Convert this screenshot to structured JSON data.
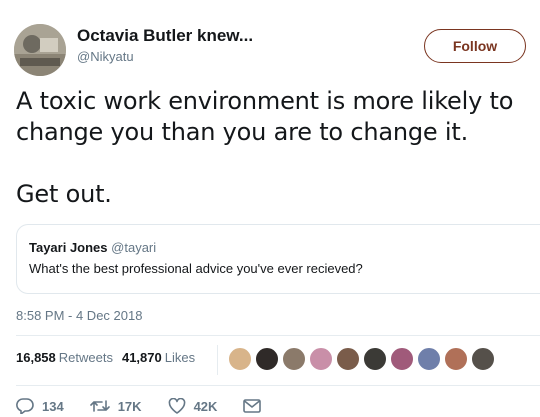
{
  "author": {
    "display_name": "Octavia Butler knew...",
    "handle": "@Nikyatu"
  },
  "follow_label": "Follow",
  "tweet": {
    "line1": "A toxic work environment is more likely to",
    "line2": "change you than you are to change it.",
    "line3": "Get out."
  },
  "quoted": {
    "name": "Tayari Jones",
    "handle": "@tayari",
    "text": "What's the best professional advice you've ever recieved?"
  },
  "timestamp": "8:58 PM - 4 Dec 2018",
  "stats": {
    "retweets_count": "16,858",
    "retweets_label": "Retweets",
    "likes_count": "41,870",
    "likes_label": "Likes"
  },
  "likers": [
    {
      "color": "#d8b48a"
    },
    {
      "color": "#2f2a28"
    },
    {
      "color": "#8b7a6a"
    },
    {
      "color": "#c98fa8"
    },
    {
      "color": "#7a5c4a"
    },
    {
      "color": "#3b3a36"
    },
    {
      "color": "#a05a7a"
    },
    {
      "color": "#6f7faa"
    },
    {
      "color": "#b07058"
    },
    {
      "color": "#55504a"
    }
  ],
  "actions": {
    "replies": "134",
    "retweets": "17K",
    "likes": "42K"
  },
  "colors": {
    "follow_accent": "#7a3520",
    "muted": "#657786",
    "text": "#14171a"
  }
}
